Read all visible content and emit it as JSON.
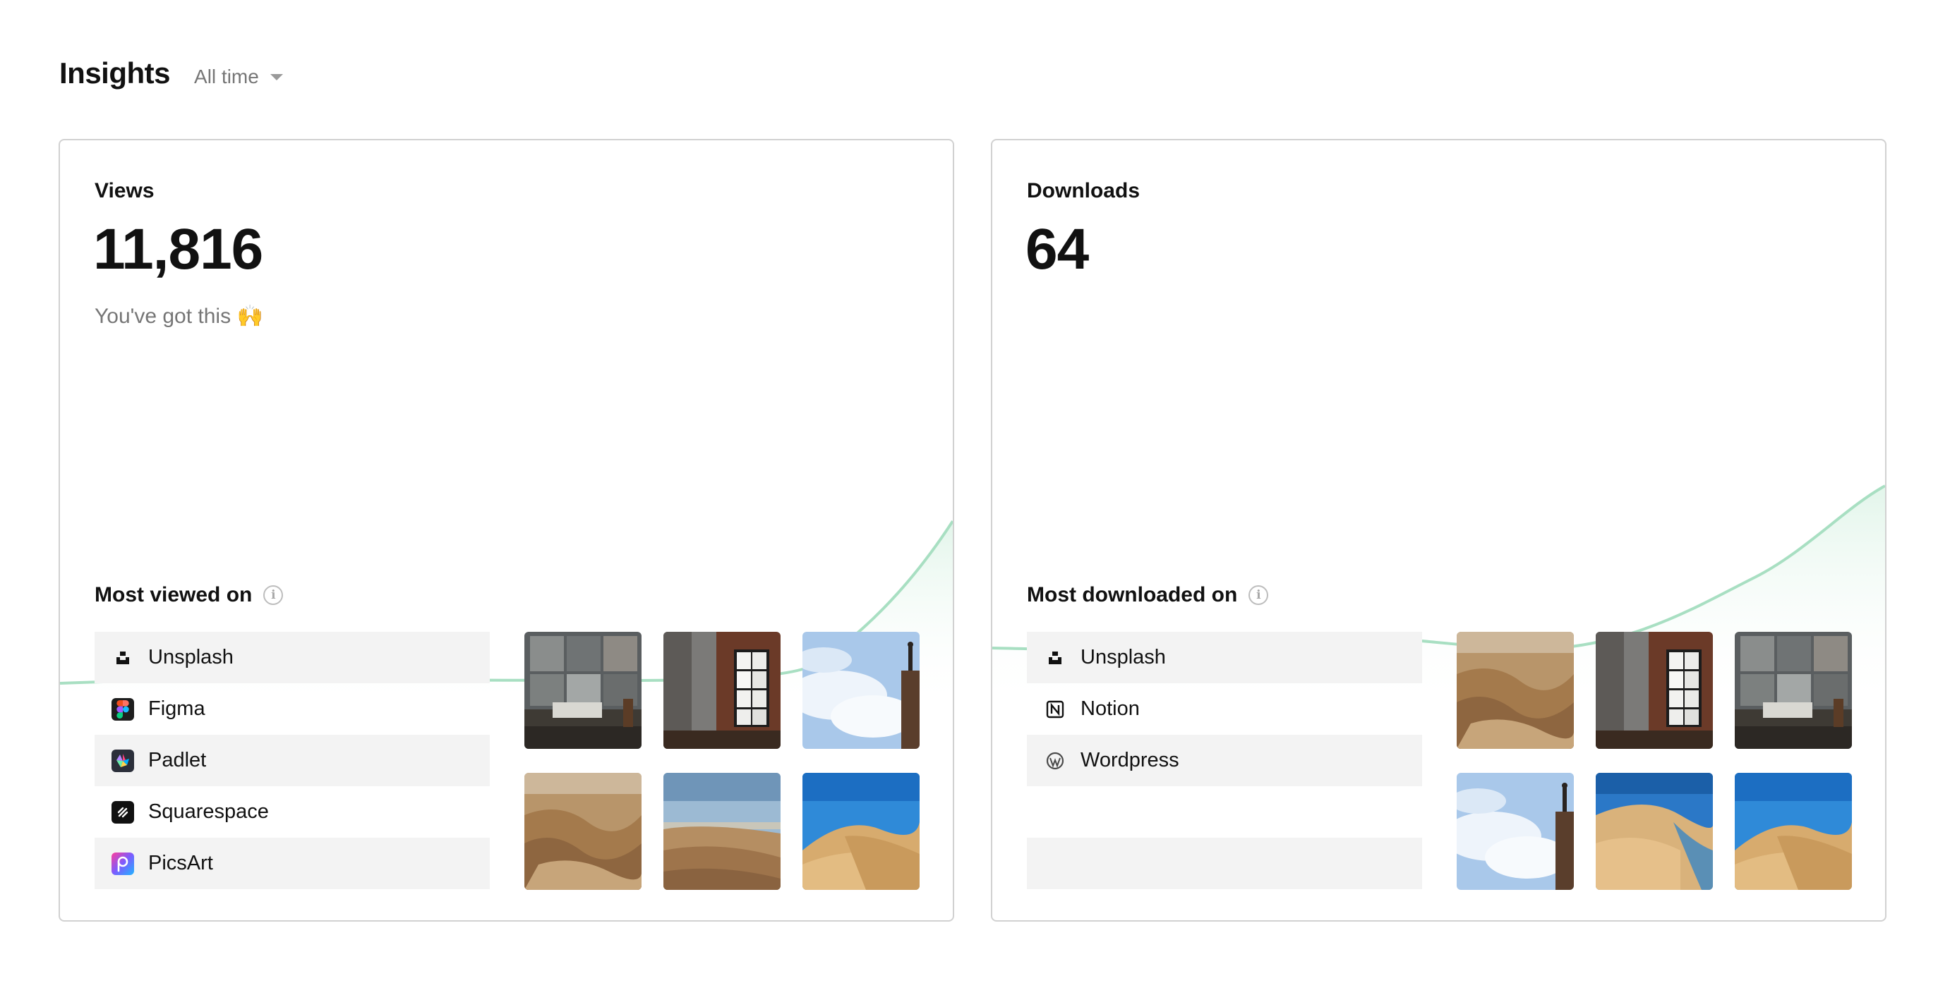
{
  "header": {
    "title": "Insights",
    "range": "All time"
  },
  "views": {
    "label": "Views",
    "value": "11,816",
    "subtitle": "You've got this",
    "subtitle_emoji": "🙌",
    "section_title": "Most viewed on",
    "platforms": [
      "Unsplash",
      "Figma",
      "Padlet",
      "Squarespace",
      "PicsArt"
    ],
    "platform_icons": [
      "unsplash-icon",
      "figma-icon",
      "padlet-icon",
      "squarespace-icon",
      "picsart-icon"
    ],
    "thumbnails": [
      "industrial-interior-photo",
      "brick-window-photo",
      "cloud-figure-photo",
      "canyon-aerial-photo",
      "desert-landscape-photo",
      "sand-dune-photo"
    ]
  },
  "downloads": {
    "label": "Downloads",
    "value": "64",
    "section_title": "Most downloaded on",
    "platforms": [
      "Unsplash",
      "Notion",
      "Wordpress"
    ],
    "platform_icons": [
      "unsplash-icon",
      "notion-icon",
      "wordpress-icon"
    ],
    "thumbnails": [
      "canyon-aerial-photo",
      "brick-window-photo",
      "industrial-interior-photo",
      "cloud-figure-photo",
      "dune-coast-photo",
      "sand-dune-photo"
    ]
  },
  "colors": {
    "line": "#a8dfc2",
    "fill": "#e4f6ec",
    "card_border": "#d1d1d1",
    "row_shade": "#f3f3f3"
  }
}
